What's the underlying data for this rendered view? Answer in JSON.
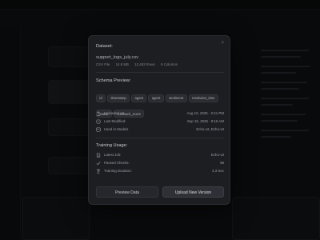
{
  "modal": {
    "dataset_title": "Dataset:",
    "file_name": "support_logs_july.csv",
    "meta": [
      "CSV File",
      "14.8 MB",
      "12,483 Rows",
      "9 Columns"
    ],
    "schema_title": "Schema Preview:",
    "schema_columns": [
      "id",
      "timestamp",
      "agent",
      "agent",
      "sentiment",
      "resolution_time",
      "status",
      "feedback_score"
    ],
    "info_rows": [
      {
        "label": "Uploaded on",
        "value": "Aug 10, 2025 - 2:41 PM",
        "icon": "upload-icon"
      },
      {
        "label": "Last Modified:",
        "value": "Sep 15, 2025 - 9:15 AM",
        "icon": "clock-icon"
      },
      {
        "label": "Used in Models",
        "value": "Echo-v2, Echo-v3",
        "icon": "database-icon"
      }
    ],
    "training_title": "Training Usage:",
    "training_rows": [
      {
        "label": "Latest Job:",
        "value": "Echo-v3",
        "icon": "document-icon"
      },
      {
        "label": "Passed Checks:",
        "value": "98",
        "icon": "check-icon"
      },
      {
        "label": "Training Duration:",
        "value": "2,3 Sec",
        "icon": "hourglass-icon"
      }
    ],
    "preview_button": "Preview Data",
    "upload_button": "Upload New Version",
    "close_glyph": "×"
  }
}
